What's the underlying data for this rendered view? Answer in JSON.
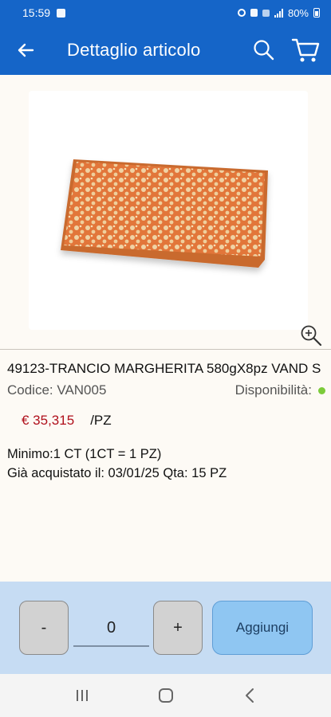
{
  "status_bar": {
    "time": "15:59",
    "battery": "80%"
  },
  "app_bar": {
    "title": "Dettaglio articolo",
    "back_icon": "arrow-left-icon",
    "search_icon": "search-icon",
    "cart_icon": "cart-icon"
  },
  "product": {
    "image_alt": "pizza-margherita-slice",
    "name": "49123-TRANCIO MARGHERITA 580gX8pz VAND S",
    "codice_label": "Codice: VAN005",
    "availability_label": "Disponibilità:",
    "availability_color": "#7ccb3a",
    "price": "€ 35,315",
    "unit": "/PZ",
    "minimo": "Minimo:1 CT (1CT = 1 PZ)",
    "gia_acquistato": "Già acquistato il: 03/01/25 Qta: 15 PZ"
  },
  "order": {
    "minus_label": "-",
    "plus_label": "+",
    "quantity": "0",
    "add_label": "Aggiungi"
  },
  "colors": {
    "brand_blue": "#1565c8",
    "price_red": "#b0101c",
    "panel_blue": "#c6dcf3",
    "add_button": "#8fc6f2"
  }
}
